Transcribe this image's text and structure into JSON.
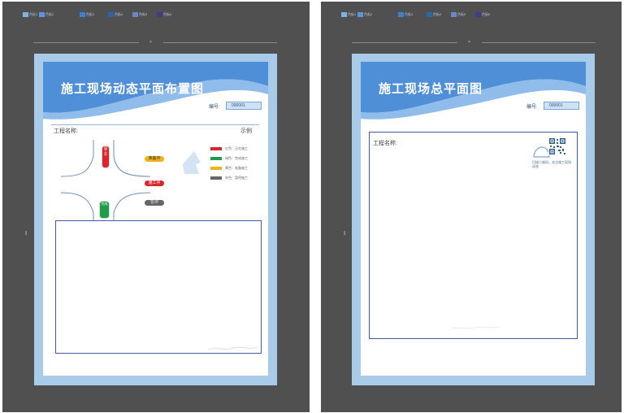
{
  "palette": {
    "canvas": "#505050",
    "border": "#a9cbea",
    "band_dark": "#4f8fd8",
    "band_light": "#8fbcea",
    "frame": "#3e5aa8",
    "red": "#d8262a",
    "green": "#1e9c4a",
    "yellow": "#f2b01e",
    "gray": "#666666"
  },
  "doc1": {
    "title": "施工现场动态平面布置图",
    "code_label": "编号:",
    "code_value": "000001",
    "project_label": "工程名称:",
    "legend_title": "示例",
    "traffic": {
      "light_red_text": "施工中",
      "light_green_text": "完成",
      "pill_yellow": "准备中",
      "pill_red": "施工中",
      "pill_gray": "暂停"
    },
    "legend": [
      {
        "color": "#d8262a",
        "text": "红色：正在施工"
      },
      {
        "color": "#1e9c4a",
        "text": "绿色：完成施工"
      },
      {
        "color": "#f2b01e",
        "text": "黄色：准备施工"
      },
      {
        "color": "#666666",
        "text": "灰色：暂停施工"
      }
    ]
  },
  "doc2": {
    "title": "施工现场总平面图",
    "code_label": "编号:",
    "code_value": "000001",
    "project_label": "工程名称:",
    "qr_note": "扫描二维码，关注施工现场动态"
  },
  "toolbar": {
    "swatches": [
      {
        "color": "#7fb1e3",
        "label": "色板1"
      },
      {
        "color": "#5b97d8",
        "label": "色板2"
      },
      {
        "color": "#3f7fcf",
        "label": "色板3"
      },
      {
        "color": "#2d64b0",
        "label": "色板4"
      },
      {
        "color": "#6a88c0",
        "label": "色板5"
      },
      {
        "color": "#3b3f86",
        "label": "色板6"
      }
    ]
  }
}
